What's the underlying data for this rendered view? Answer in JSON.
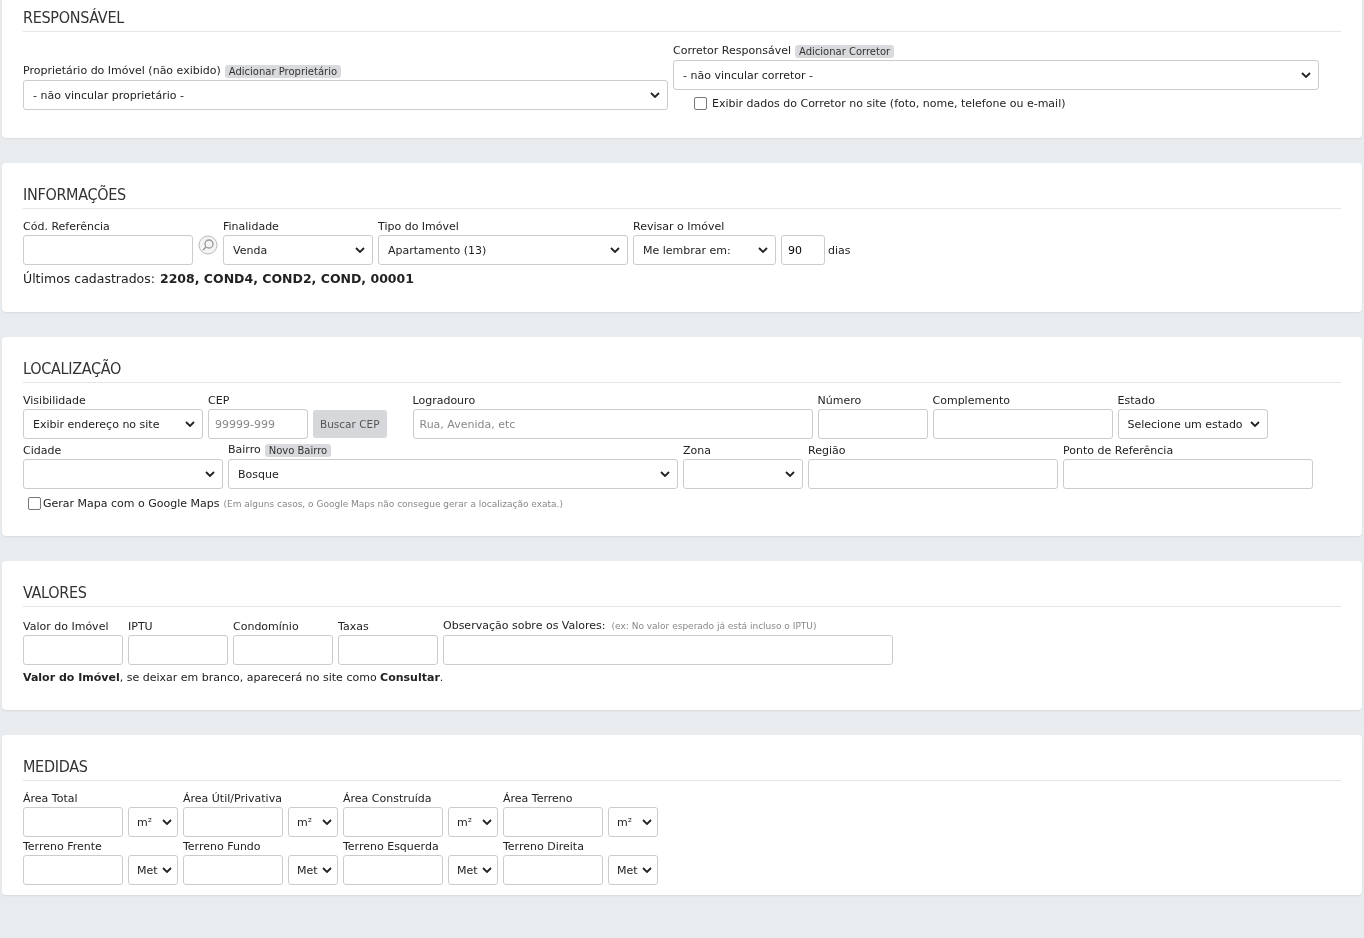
{
  "responsavel": {
    "title": "RESPONSÁVEL",
    "owner": {
      "label": "Proprietário do Imóvel (não exibido)",
      "add_button": "Adicionar Proprietário",
      "value": "- não vincular proprietário -"
    },
    "broker": {
      "label": "Corretor Responsável",
      "add_button": "Adicionar Corretor",
      "value": "- não vincular corretor -"
    },
    "show_broker": {
      "label": "Exibir dados do Corretor no site (foto, nome, telefone ou e-mail)",
      "checked": false
    }
  },
  "informacoes": {
    "title": "INFORMAÇÕES",
    "ref": {
      "label": "Cód. Referência"
    },
    "finalidade": {
      "label": "Finalidade",
      "value": "Venda"
    },
    "tipo": {
      "label": "Tipo do Imóvel",
      "value": "Apartamento (13)"
    },
    "revisar": {
      "label": "Revisar o Imóvel",
      "value": "Me lembrar em:",
      "days": "90",
      "unit": "dias"
    },
    "recent": {
      "label": "Últimos cadastrados:",
      "codes": "2208, COND4, COND2, COND, 00001"
    }
  },
  "localizacao": {
    "title": "LOCALIZAÇÃO",
    "visibilidade": {
      "label": "Visibilidade",
      "value": "Exibir endereço no site"
    },
    "cep": {
      "label": "CEP",
      "placeholder": "99999-999",
      "button": "Buscar CEP"
    },
    "logradouro": {
      "label": "Logradouro",
      "placeholder": "Rua, Avenida, etc"
    },
    "numero": {
      "label": "Número"
    },
    "complemento": {
      "label": "Complemento"
    },
    "estado": {
      "label": "Estado",
      "value": "Selecione um estado"
    },
    "cidade": {
      "label": "Cidade"
    },
    "bairro": {
      "label": "Bairro",
      "add_button": "Novo Bairro",
      "value": "Bosque"
    },
    "zona": {
      "label": "Zona"
    },
    "regiao": {
      "label": "Região"
    },
    "referencia": {
      "label": "Ponto de Referência"
    },
    "map": {
      "label": "Gerar Mapa com o Google Maps",
      "note": "(Em alguns casos, o Google Maps não consegue gerar a localização exata.)",
      "checked": false
    }
  },
  "valores": {
    "title": "VALORES",
    "fields": [
      {
        "label": "Valor do Imóvel"
      },
      {
        "label": "IPTU"
      },
      {
        "label": "Condomínio"
      },
      {
        "label": "Taxas"
      }
    ],
    "obs": {
      "label": "Observação sobre os Valores:",
      "hint": "(ex: No valor esperado já está incluso o IPTU)"
    },
    "note": "**Valor do Imóvel**, se deixar em branco, aparecerá no site como **Consultar**."
  },
  "medidas": {
    "title": "MEDIDAS",
    "rows": [
      [
        {
          "label": "Área Total",
          "unit": "m²"
        },
        {
          "label": "Área Útil/Privativa",
          "unit": "m²"
        },
        {
          "label": "Área Construída",
          "unit": "m²"
        },
        {
          "label": "Área Terreno",
          "unit": "m²"
        }
      ],
      [
        {
          "label": "Terreno Frente",
          "unit": "Met"
        },
        {
          "label": "Terreno Fundo",
          "unit": "Met"
        },
        {
          "label": "Terreno Esquerda",
          "unit": "Met"
        },
        {
          "label": "Terreno Direita",
          "unit": "Met"
        }
      ]
    ]
  }
}
